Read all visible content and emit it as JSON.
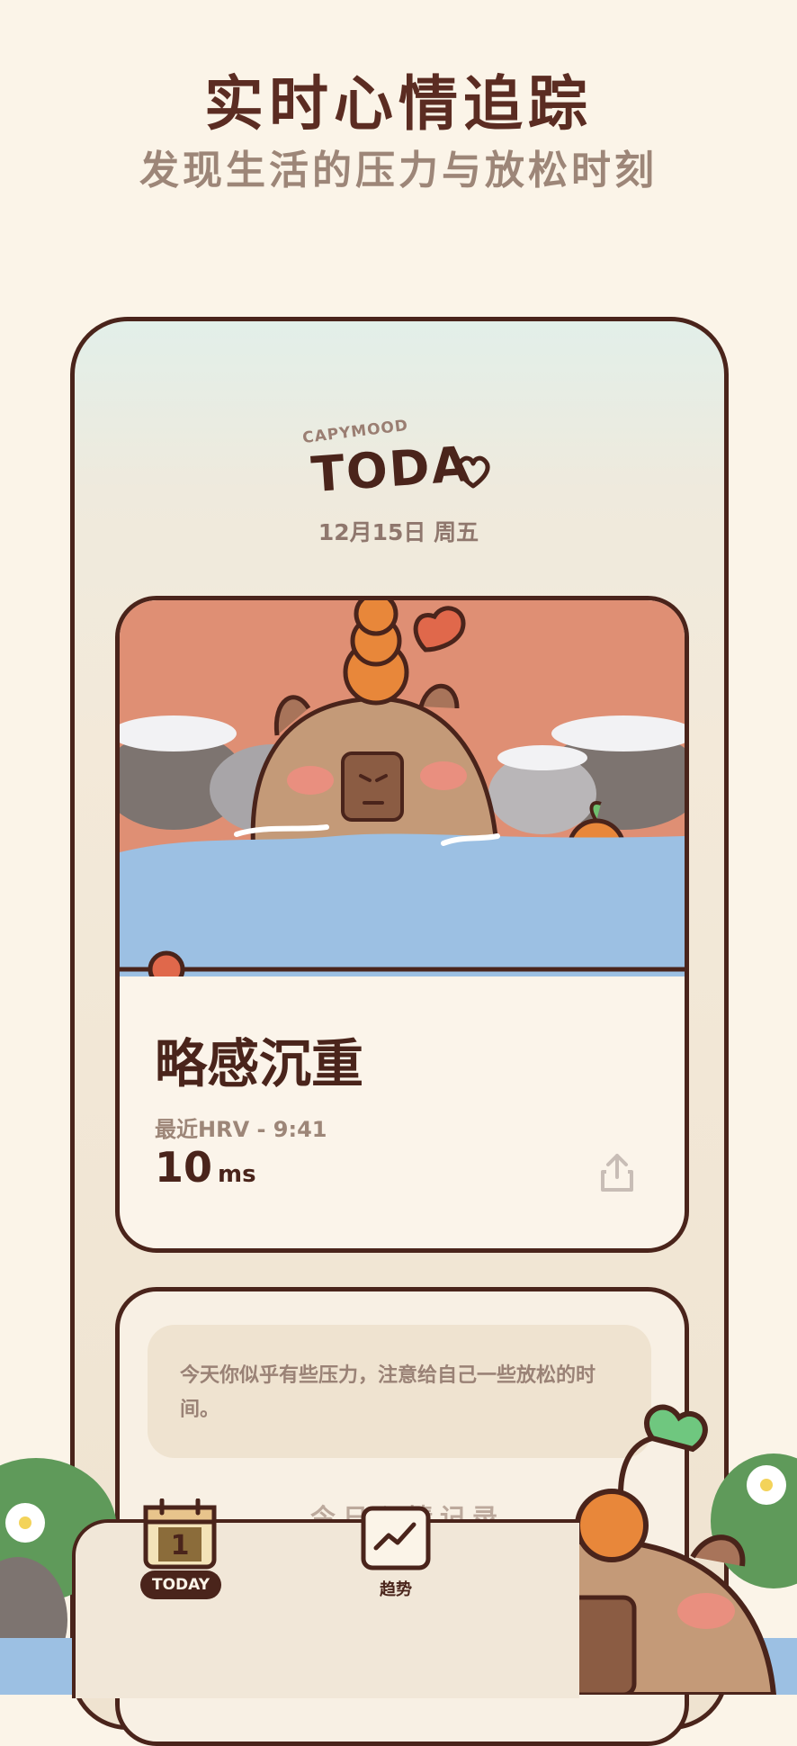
{
  "headline": "实时心情追踪",
  "subheadline": "发现生活的压力与放松时刻",
  "app": {
    "brand_small": "CAPYMOOD",
    "brand_big": "TODA",
    "date": "12月15日 周五"
  },
  "mood_card": {
    "title": "略感沉重",
    "hrv_label": "最近HRV - 9:41",
    "hrv_value": "10",
    "hrv_unit": "ms"
  },
  "tip_card": {
    "message": "今天你似乎有些压力，注意给自己一些放松的时间。",
    "section_title": "今日心情记录"
  },
  "tabbar": {
    "today_number": "1",
    "today_label": "TODAY",
    "trend_label": "趋势"
  },
  "colors": {
    "dark_brown": "#4a241b",
    "cream": "#fbf4e8",
    "orange": "#e8873a",
    "water_blue": "#9cc0e3",
    "sky_salmon": "#df8f74"
  },
  "icons": [
    "heart-icon",
    "share-icon",
    "calendar-icon",
    "trend-chart-icon"
  ]
}
